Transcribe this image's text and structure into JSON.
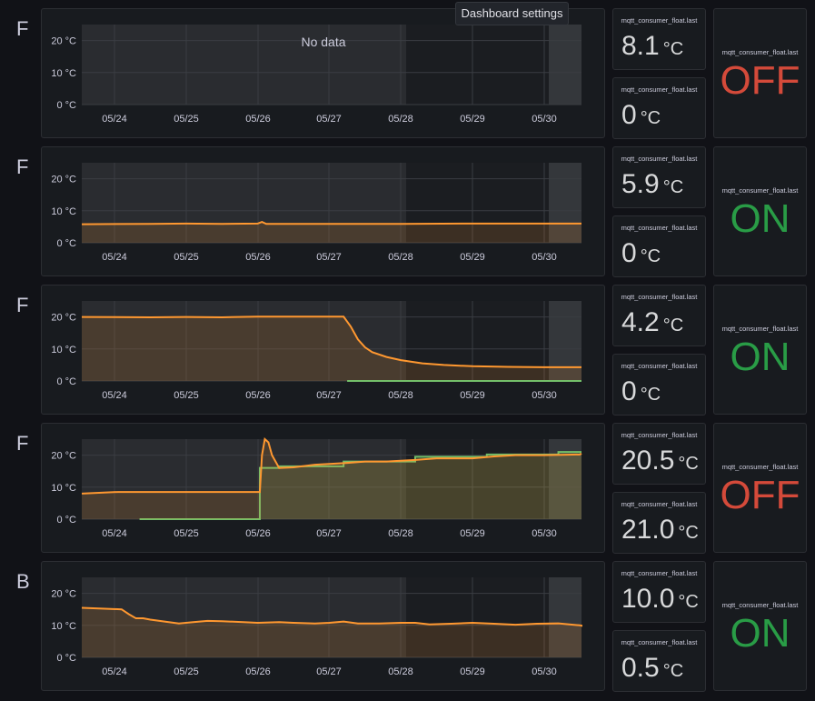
{
  "tooltip": "Dashboard settings",
  "colors": {
    "orange": "#ff9830",
    "green": "#73bf69",
    "on": "#299c46",
    "off": "#d44a3a"
  },
  "rows": [
    {
      "letter": "F",
      "chart_data": {
        "type": "line",
        "x_ticks": [
          "05/24",
          "05/25",
          "05/26",
          "05/27",
          "05/28",
          "05/29",
          "05/30"
        ],
        "y_ticks": [
          "0 °C",
          "10 °C",
          "20 °C"
        ],
        "ylim": [
          0,
          25
        ],
        "no_data": "No data",
        "series": []
      },
      "stat_top": {
        "title": "mqtt_consumer_float.last",
        "value": "8.1",
        "unit": "°C"
      },
      "stat_bottom": {
        "title": "mqtt_consumer_float.last",
        "value": "0",
        "unit": "°C"
      },
      "state": {
        "title": "mqtt_consumer_float.last",
        "value": "OFF",
        "color": "#d44a3a"
      }
    },
    {
      "letter": "F",
      "chart_data": {
        "type": "area",
        "x_ticks": [
          "05/24",
          "05/25",
          "05/26",
          "05/27",
          "05/28",
          "05/29",
          "05/30"
        ],
        "y_ticks": [
          "0 °C",
          "10 °C",
          "20 °C"
        ],
        "ylim": [
          0,
          25
        ],
        "no_data": "",
        "series": [
          {
            "color": "#ff9830",
            "fill": true,
            "points": [
              [
                0,
                5.8
              ],
              [
                0.5,
                5.9
              ],
              [
                1,
                6
              ],
              [
                1.5,
                5.9
              ],
              [
                2,
                6
              ],
              [
                2.06,
                6.5
              ],
              [
                2.12,
                5.9
              ],
              [
                2.5,
                5.9
              ],
              [
                3,
                5.9
              ],
              [
                3.5,
                5.9
              ],
              [
                4,
                5.9
              ],
              [
                5,
                6
              ],
              [
                6,
                6
              ],
              [
                7,
                6
              ]
            ]
          }
        ]
      },
      "stat_top": {
        "title": "mqtt_consumer_float.last",
        "value": "5.9",
        "unit": "°C"
      },
      "stat_bottom": {
        "title": "mqtt_consumer_float.last",
        "value": "0",
        "unit": "°C"
      },
      "state": {
        "title": "mqtt_consumer_float.last",
        "value": "ON",
        "color": "#299c46"
      }
    },
    {
      "letter": "F",
      "chart_data": {
        "type": "area",
        "x_ticks": [
          "05/24",
          "05/25",
          "05/26",
          "05/27",
          "05/28",
          "05/29",
          "05/30"
        ],
        "y_ticks": [
          "0 °C",
          "10 °C",
          "20 °C"
        ],
        "ylim": [
          0,
          25
        ],
        "no_data": "",
        "series": [
          {
            "color": "#ff9830",
            "fill": true,
            "points": [
              [
                0,
                20
              ],
              [
                0.5,
                19.9
              ],
              [
                1,
                20
              ],
              [
                1.5,
                19.9
              ],
              [
                2,
                20.1
              ],
              [
                2.5,
                20.1
              ],
              [
                3.2,
                20.1
              ],
              [
                3.3,
                17
              ],
              [
                3.4,
                13
              ],
              [
                3.5,
                10.5
              ],
              [
                3.6,
                9
              ],
              [
                3.8,
                7.5
              ],
              [
                4,
                6.5
              ],
              [
                4.3,
                5.5
              ],
              [
                4.6,
                5
              ],
              [
                5,
                4.6
              ],
              [
                5.5,
                4.4
              ],
              [
                6,
                4.3
              ],
              [
                6.5,
                4.3
              ],
              [
                7,
                4.3
              ]
            ]
          },
          {
            "color": "#73bf69",
            "fill": false,
            "points": [
              [
                3.25,
                0
              ],
              [
                7,
                0
              ]
            ]
          }
        ]
      },
      "stat_top": {
        "title": "mqtt_consumer_float.last",
        "value": "4.2",
        "unit": "°C"
      },
      "stat_bottom": {
        "title": "mqtt_consumer_float.last",
        "value": "0",
        "unit": "°C"
      },
      "state": {
        "title": "mqtt_consumer_float.last",
        "value": "ON",
        "color": "#299c46"
      }
    },
    {
      "letter": "F",
      "chart_data": {
        "type": "area",
        "x_ticks": [
          "05/24",
          "05/25",
          "05/26",
          "05/27",
          "05/28",
          "05/29",
          "05/30"
        ],
        "y_ticks": [
          "0 °C",
          "10 °C",
          "20 °C"
        ],
        "ylim": [
          0,
          25
        ],
        "no_data": "",
        "series": [
          {
            "color": "#73bf69",
            "fill": true,
            "points": [
              [
                0.35,
                0
              ],
              [
                2.03,
                0
              ],
              [
                2.03,
                16
              ],
              [
                2.3,
                16
              ],
              [
                2.3,
                16.5
              ],
              [
                3.2,
                16.5
              ],
              [
                3.2,
                18
              ],
              [
                4.2,
                18
              ],
              [
                4.2,
                19.5
              ],
              [
                5.2,
                19.5
              ],
              [
                5.2,
                20.2
              ],
              [
                6.2,
                20.2
              ],
              [
                6.2,
                21
              ],
              [
                7,
                21
              ]
            ]
          },
          {
            "color": "#ff9830",
            "fill": true,
            "points": [
              [
                0,
                8
              ],
              [
                0.05,
                8.5
              ],
              [
                0.5,
                8.5
              ],
              [
                1,
                8.5
              ],
              [
                1.5,
                8.5
              ],
              [
                2.03,
                8.5
              ],
              [
                2.06,
                20
              ],
              [
                2.1,
                26
              ],
              [
                2.15,
                24
              ],
              [
                2.2,
                20
              ],
              [
                2.3,
                16
              ],
              [
                2.5,
                16.2
              ],
              [
                2.8,
                17
              ],
              [
                3.2,
                17.5
              ],
              [
                3.5,
                18
              ],
              [
                3.8,
                18
              ],
              [
                4.2,
                18.5
              ],
              [
                4.5,
                19
              ],
              [
                5,
                19
              ],
              [
                5.3,
                19.6
              ],
              [
                5.6,
                20
              ],
              [
                6,
                20
              ],
              [
                6.5,
                20.2
              ],
              [
                7,
                20.5
              ]
            ]
          }
        ]
      },
      "stat_top": {
        "title": "mqtt_consumer_float.last",
        "value": "20.5",
        "unit": "°C"
      },
      "stat_bottom": {
        "title": "mqtt_consumer_float.last",
        "value": "21.0",
        "unit": "°C"
      },
      "state": {
        "title": "mqtt_consumer_float.last",
        "value": "OFF",
        "color": "#d44a3a"
      }
    },
    {
      "letter": "B",
      "chart_data": {
        "type": "area",
        "x_ticks": [
          "05/24",
          "05/25",
          "05/26",
          "05/27",
          "05/28",
          "05/29",
          "05/30"
        ],
        "y_ticks": [
          "0 °C",
          "10 °C",
          "20 °C"
        ],
        "ylim": [
          0,
          25
        ],
        "no_data": "",
        "series": [
          {
            "color": "#ff9830",
            "fill": true,
            "points": [
              [
                0,
                15.5
              ],
              [
                0.1,
                15
              ],
              [
                0.2,
                13.5
              ],
              [
                0.3,
                12.2
              ],
              [
                0.4,
                12.2
              ],
              [
                0.5,
                11.8
              ],
              [
                0.7,
                11.2
              ],
              [
                0.9,
                10.6
              ],
              [
                1.1,
                11
              ],
              [
                1.3,
                11.4
              ],
              [
                1.5,
                11.3
              ],
              [
                1.8,
                11
              ],
              [
                2,
                10.8
              ],
              [
                2.3,
                11
              ],
              [
                2.5,
                10.8
              ],
              [
                2.8,
                10.6
              ],
              [
                3,
                10.8
              ],
              [
                3.2,
                11.2
              ],
              [
                3.4,
                10.6
              ],
              [
                3.7,
                10.6
              ],
              [
                4,
                10.8
              ],
              [
                4.2,
                10.8
              ],
              [
                4.4,
                10.3
              ],
              [
                4.7,
                10.5
              ],
              [
                5,
                10.8
              ],
              [
                5.3,
                10.5
              ],
              [
                5.6,
                10.2
              ],
              [
                5.9,
                10.5
              ],
              [
                6.2,
                10.6
              ],
              [
                6.5,
                10
              ],
              [
                6.8,
                9.9
              ],
              [
                7,
                10.2
              ]
            ]
          }
        ]
      },
      "stat_top": {
        "title": "mqtt_consumer_float.last",
        "value": "10.0",
        "unit": "°C"
      },
      "stat_bottom": {
        "title": "mqtt_consumer_float.last",
        "value": "0.5",
        "unit": "°C"
      },
      "state": {
        "title": "mqtt_consumer_float.last",
        "value": "ON",
        "color": "#299c46"
      }
    }
  ]
}
